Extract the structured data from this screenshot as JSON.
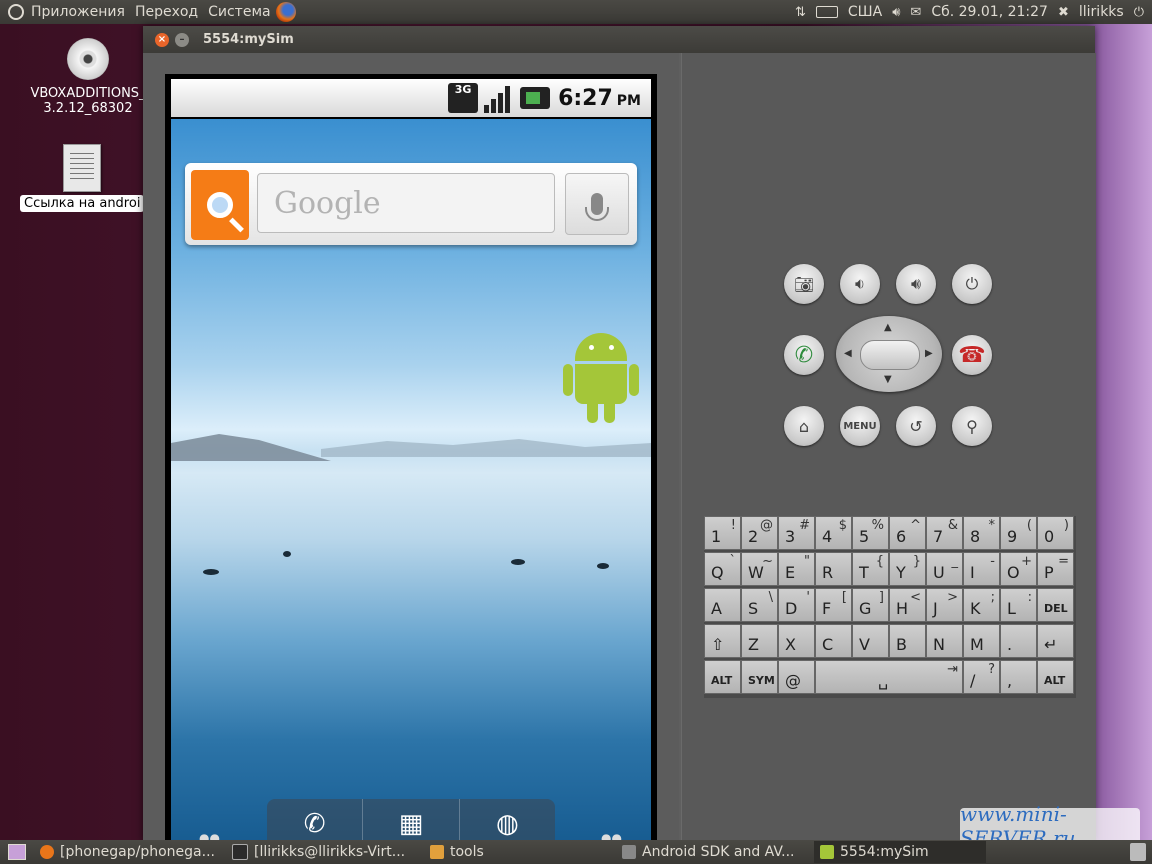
{
  "top_panel": {
    "menus": [
      "Приложения",
      "Переход",
      "Система"
    ],
    "keyboard_layout": "США",
    "datetime": "Сб. 29.01, 21:27",
    "user": "llirikks"
  },
  "desktop": {
    "icons": [
      {
        "label_line1": "VBOXADDITIONS_",
        "label_line2": "3.2.12_68302"
      },
      {
        "label": "Ссылка на androi"
      }
    ]
  },
  "window": {
    "title": "5554:mySim"
  },
  "phone": {
    "status": {
      "network": "3G",
      "time": "6:27",
      "ampm": "PM"
    },
    "search_widget": {
      "placeholder": "Google"
    },
    "dock_icons": [
      "phone-icon",
      "apps-grid-icon",
      "browser-icon"
    ]
  },
  "controls": {
    "menu_label": "MENU"
  },
  "keyboard": {
    "rows": [
      [
        {
          "m": "1",
          "a": "!"
        },
        {
          "m": "2",
          "a": "@"
        },
        {
          "m": "3",
          "a": "#"
        },
        {
          "m": "4",
          "a": "$"
        },
        {
          "m": "5",
          "a": "%"
        },
        {
          "m": "6",
          "a": "^"
        },
        {
          "m": "7",
          "a": "&"
        },
        {
          "m": "8",
          "a": "*"
        },
        {
          "m": "9",
          "a": "("
        },
        {
          "m": "0",
          "a": ")"
        }
      ],
      [
        {
          "m": "Q",
          "a": "`"
        },
        {
          "m": "W",
          "a": "~"
        },
        {
          "m": "E",
          "a": "\""
        },
        {
          "m": "R",
          "a": ""
        },
        {
          "m": "T",
          "a": "{"
        },
        {
          "m": "Y",
          "a": "}"
        },
        {
          "m": "U",
          "a": "_"
        },
        {
          "m": "I",
          "a": "-"
        },
        {
          "m": "O",
          "a": "+"
        },
        {
          "m": "P",
          "a": "="
        }
      ],
      [
        {
          "m": "A",
          "a": ""
        },
        {
          "m": "S",
          "a": "\\"
        },
        {
          "m": "D",
          "a": "'"
        },
        {
          "m": "F",
          "a": "["
        },
        {
          "m": "G",
          "a": "]"
        },
        {
          "m": "H",
          "a": "<"
        },
        {
          "m": "J",
          "a": ">"
        },
        {
          "m": "K",
          "a": ";"
        },
        {
          "m": "L",
          "a": ":"
        },
        {
          "m": "DEL",
          "a": ""
        }
      ],
      [
        {
          "m": "⇧",
          "a": ""
        },
        {
          "m": "Z",
          "a": ""
        },
        {
          "m": "X",
          "a": ""
        },
        {
          "m": "C",
          "a": ""
        },
        {
          "m": "V",
          "a": ""
        },
        {
          "m": "B",
          "a": ""
        },
        {
          "m": "N",
          "a": ""
        },
        {
          "m": "M",
          "a": ""
        },
        {
          "m": ".",
          "a": ""
        },
        {
          "m": "↵",
          "a": ""
        }
      ]
    ],
    "bottom": {
      "alt_left": "ALT",
      "sym": "SYM",
      "at": "@",
      "slash": "/",
      "question": "?",
      "comma": ",",
      "alt_right": "ALT"
    }
  },
  "watermark": "www.mini-SERVER.ru",
  "taskbar": {
    "tasks": [
      {
        "label": "[phonegap/phonega..."
      },
      {
        "label": "[llirikks@llirikks-Virt..."
      },
      {
        "label": "tools"
      },
      {
        "label": "Android SDK and AV..."
      },
      {
        "label": "5554:mySim"
      }
    ]
  }
}
